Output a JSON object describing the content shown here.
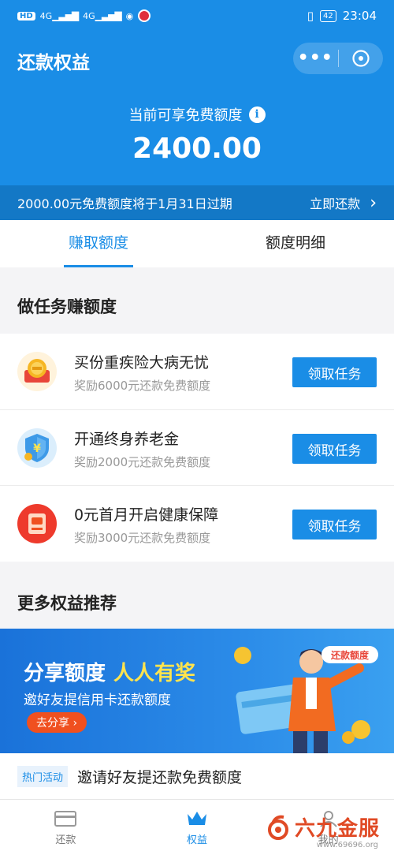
{
  "status_bar": {
    "left_chips": [
      "HD",
      "4G",
      "4G"
    ],
    "time": "23:04",
    "battery": "42"
  },
  "header": {
    "title": "还款权益",
    "more_label": "•••",
    "quota_label": "当前可享免费额度",
    "quota_amount": "2400.00"
  },
  "expire_bar": {
    "text": "2000.00元免费额度将于1月31日过期",
    "action": "立即还款",
    "chevron": "›"
  },
  "tabs": [
    {
      "label": "赚取额度",
      "active": true
    },
    {
      "label": "额度明细",
      "active": false
    }
  ],
  "tasks_section": {
    "title": "做任务赚额度",
    "items": [
      {
        "name": "买份重疾险大病无忧",
        "desc": "奖励6000元还款免费额度",
        "button": "领取任务",
        "icon": "gold-coin-icon"
      },
      {
        "name": "开通终身养老金",
        "desc": "奖励2000元还款免费额度",
        "button": "领取任务",
        "icon": "shield-yuan-icon"
      },
      {
        "name": "0元首月开启健康保障",
        "desc": "奖励3000元还款免费额度",
        "button": "领取任务",
        "icon": "health-card-icon"
      }
    ]
  },
  "more_section": {
    "title": "更多权益推荐"
  },
  "banner": {
    "title_main": "分享额度",
    "title_highlight": "人人有奖",
    "subtitle": "邀好友提信用卡还款额度",
    "button": "去分享 ›",
    "tag": "还款额度"
  },
  "hot_row": {
    "tag": "热门活动",
    "text": "邀请好友提还款免费额度"
  },
  "tabbar": [
    {
      "label": "还款",
      "icon": "card-icon",
      "active": false
    },
    {
      "label": "权益",
      "icon": "crown-icon",
      "active": true
    },
    {
      "label": "我的",
      "icon": "user-icon",
      "active": false
    }
  ],
  "watermark": {
    "brand": "六九金服",
    "url": "www.69696.org"
  },
  "colors": {
    "primary": "#1a8de6",
    "expire_bar": "#1378c6",
    "banner_button": "#f0501f",
    "highlight_yellow": "#ffe44d"
  }
}
